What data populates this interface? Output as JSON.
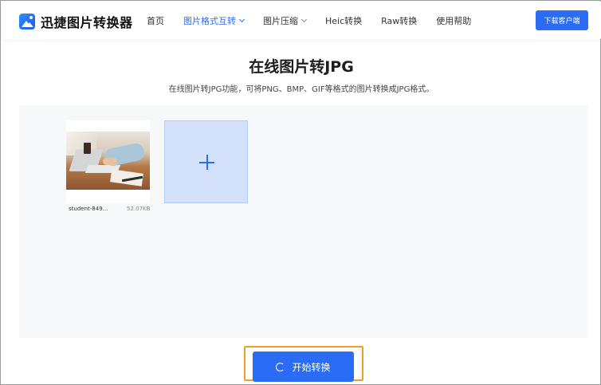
{
  "header": {
    "logo_text": "迅捷图片转换器",
    "nav": [
      {
        "label": "首页"
      },
      {
        "label": "图片格式互转"
      },
      {
        "label": "图片压缩"
      },
      {
        "label": "Heic转换"
      },
      {
        "label": "Raw转换"
      },
      {
        "label": "使用帮助"
      }
    ],
    "download_label": "下载客户端"
  },
  "main": {
    "title": "在线图片转JPG",
    "subtitle": "在线图片转JPG功能，可将PNG、BMP、GIF等格式的图片转换成JPG格式。"
  },
  "files": [
    {
      "name": "student-849...",
      "size": "52.07KB"
    }
  ],
  "actions": {
    "start_label": "开始转换"
  },
  "colors": {
    "accent": "#2a6cf6",
    "highlight_outline": "#f39c2c",
    "add_tile_bg": "#d3e1fb",
    "workspace_bg": "#f7f8fa"
  }
}
